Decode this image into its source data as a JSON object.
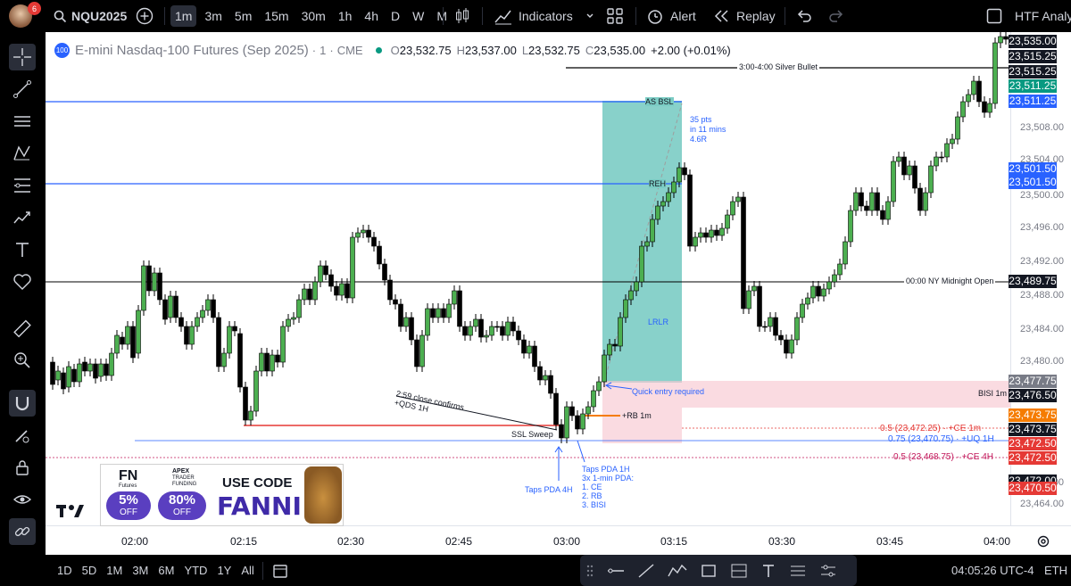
{
  "topbar": {
    "notification_count": "6",
    "symbol": "NQU2025",
    "intervals": [
      "1m",
      "3m",
      "5m",
      "15m",
      "30m",
      "1h",
      "4h",
      "D",
      "W",
      "M"
    ],
    "active_interval": "1m",
    "indicators_label": "Indicators",
    "alert_label": "Alert",
    "replay_label": "Replay",
    "layout_label": "HTF Analys"
  },
  "legend": {
    "badge": "100",
    "title": "E-mini Nasdaq-100 Futures (Sep 2025)",
    "interval": "1",
    "exchange": "CME",
    "o_label": "O",
    "o": "23,532.75",
    "h_label": "H",
    "h": "23,537.00",
    "l_label": "L",
    "l": "23,532.75",
    "c_label": "C",
    "c": "23,535.00",
    "change": "+2.00 (+0.01%)"
  },
  "price_axis": {
    "ticks": [
      "23,508.00",
      "23,504.00",
      "23,500.00",
      "23,496.00",
      "23,492.00",
      "23,488.00",
      "23,484.00",
      "23,480.00",
      "23,468.00",
      "23,464.00"
    ],
    "labels": [
      {
        "text": "23,535.00",
        "bg": "#131722"
      },
      {
        "text": "23,515.25",
        "bg": "#131722"
      },
      {
        "text": "23,515.25",
        "bg": "#131722"
      },
      {
        "text": "23,511.25",
        "bg": "#089981"
      },
      {
        "text": "23,511.25",
        "bg": "#089981"
      },
      {
        "text": "23,511.25",
        "bg": "#2962ff"
      },
      {
        "text": "23,501.50",
        "bg": "#2962ff"
      },
      {
        "text": "23,501.50",
        "bg": "#2962ff"
      },
      {
        "text": "23,489.75",
        "bg": "#131722"
      },
      {
        "text": "23,477.75",
        "bg": "#787b86"
      },
      {
        "text": "23,476.50",
        "bg": "#131722"
      },
      {
        "text": "23,473.75",
        "bg": "#f57c00"
      },
      {
        "text": "23,473.75",
        "bg": "#131722"
      },
      {
        "text": "23,472.50",
        "bg": "#e53935"
      },
      {
        "text": "23,472.50",
        "bg": "#e53935"
      },
      {
        "text": "23,472.00",
        "bg": "#131722"
      },
      {
        "text": "23,470.50",
        "bg": "#e53935"
      }
    ]
  },
  "time_axis": [
    "02:00",
    "02:15",
    "02:30",
    "02:45",
    "03:00",
    "03:15",
    "03:30",
    "03:45",
    "04:00"
  ],
  "annotations": {
    "silver_bullet": "3:00-4:00 Silver Bullet",
    "as_bsl": "AS BSL",
    "reh": "REH",
    "pts1": "35 pts",
    "pts2": "in 11 mins",
    "pts3": "4.6R",
    "lrlr": "LRLR",
    "midnight": "00:00 NY Midnight Open",
    "quick_entry": "Quick entry required",
    "bisi": "BISI 1m",
    "rb": "+RB 1m",
    "ce1": "0.5 (23,472.25) · +CE 1m",
    "uq": "0.75 (23,470.75) · +UQ 1H",
    "ce4": "0.5 (23,468.75) · +CE 4H",
    "ssl": "SSL Sweep",
    "close1": "2:59 close confirms",
    "close2": "+QDS 1H",
    "taps4h": "Taps PDA 4H",
    "taps1h": "Taps PDA 1H",
    "taps_l2": "3x 1-min PDA:",
    "taps_l3": "1. CE",
    "taps_l4": "2. RB",
    "taps_l5": "3. BISI"
  },
  "ad": {
    "fn_logo": "FN",
    "fn_sub": "Futures",
    "fn_pct": "5%",
    "fn_off": "OFF",
    "apex1": "APEX",
    "apex2": "TRADER",
    "apex3": "FUNDING",
    "apex_pct": "80%",
    "apex_off": "OFF",
    "use_code": "USE CODE",
    "code": "FANNI"
  },
  "bottombar": {
    "ranges": [
      "1D",
      "5D",
      "1M",
      "3M",
      "6M",
      "YTD",
      "1Y",
      "All"
    ],
    "clock": "04:05:26 UTC-4",
    "session": "ETH"
  },
  "colors": {
    "up": "#4caf50",
    "down": "#000000",
    "blue_line": "#2962ff",
    "green_zone": "#7bccc4",
    "pink_zone": "#f8c7d1"
  }
}
